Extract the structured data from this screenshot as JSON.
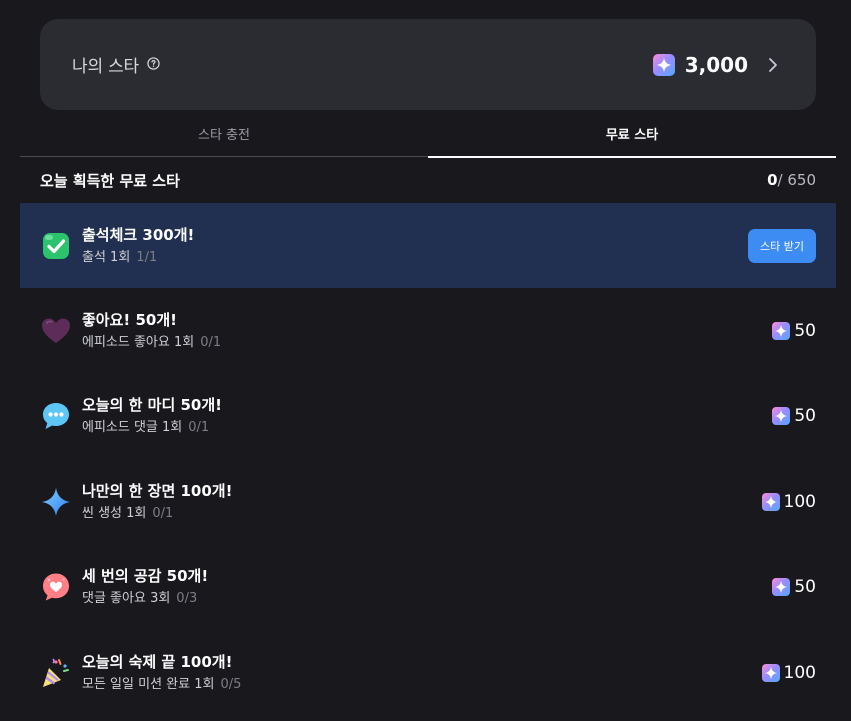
{
  "star_card": {
    "label": "나의 스타",
    "balance": "3,000"
  },
  "tabs": [
    {
      "label": "스타 충전",
      "active": false
    },
    {
      "label": "무료 스타",
      "active": true
    }
  ],
  "summary": {
    "title": "오늘 획득한 무료 스타",
    "current": "0",
    "total": "/ 650"
  },
  "missions": [
    {
      "title": "출석체크 300개!",
      "subtitle": "출석 1회",
      "progress": "1/1",
      "icon": "check-icon",
      "action_label": "스타 받기"
    },
    {
      "title": "좋아요! 50개!",
      "subtitle": "에피소드 좋아요 1회",
      "progress": "0/1",
      "icon": "heart-icon",
      "reward": "50"
    },
    {
      "title": "오늘의 한 마디 50개!",
      "subtitle": "에피소드 댓글 1회",
      "progress": "0/1",
      "icon": "speech-bubble-icon",
      "reward": "50"
    },
    {
      "title": "나만의 한 장면 100개!",
      "subtitle": "씬 생성 1회",
      "progress": "0/1",
      "icon": "sparkle-icon",
      "reward": "100"
    },
    {
      "title": "세 번의 공감 50개!",
      "subtitle": "댓글 좋아요 3회",
      "progress": "0/3",
      "icon": "heart-bubble-icon",
      "reward": "50"
    },
    {
      "title": "오늘의 숙제 끝 100개!",
      "subtitle": "모든 일일 미션 완료 1회",
      "progress": "0/5",
      "icon": "party-popper-icon",
      "reward": "100"
    }
  ],
  "colors": {
    "background": "#18181d",
    "card": "#2a2c31",
    "active_row": "#212f50",
    "accent": "#3d8cf4"
  }
}
